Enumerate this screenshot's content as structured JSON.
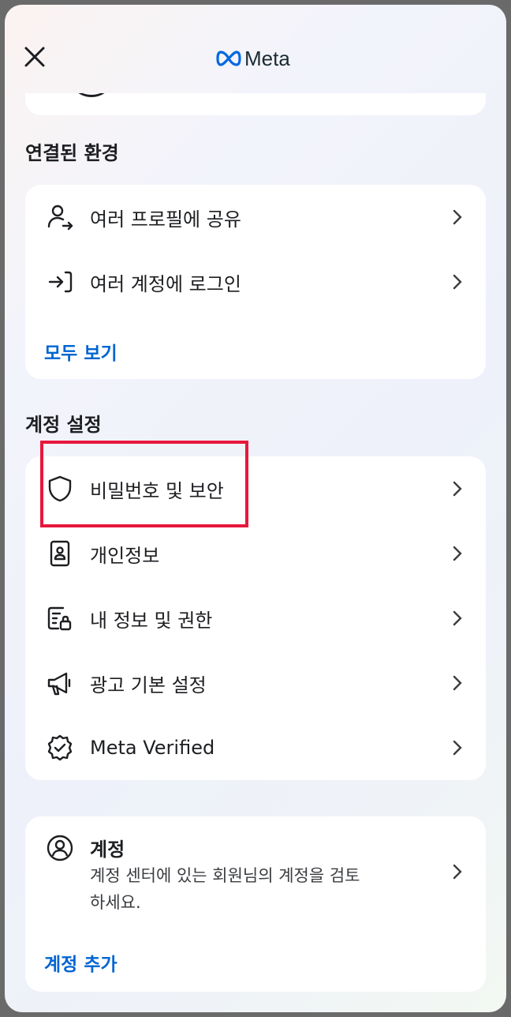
{
  "header": {
    "logo_text": "Meta"
  },
  "connected": {
    "title": "연결된 환경",
    "items": [
      {
        "label": "여러 프로필에 공유",
        "icon": "share-profiles-icon"
      },
      {
        "label": "여러 계정에 로그인",
        "icon": "login-arrow-icon"
      }
    ],
    "see_all": "모두 보기"
  },
  "account_settings": {
    "title": "계정 설정",
    "items": [
      {
        "label": "비밀번호 및 보안",
        "icon": "shield-icon"
      },
      {
        "label": "개인정보",
        "icon": "id-card-icon"
      },
      {
        "label": "내 정보 및 권한",
        "icon": "info-permissions-icon"
      },
      {
        "label": "광고 기본 설정",
        "icon": "megaphone-icon"
      },
      {
        "label": "Meta Verified",
        "icon": "verified-badge-icon"
      }
    ]
  },
  "accounts": {
    "title": "계정",
    "description": "계정 센터에 있는 회원님의 계정을 검토하세요.",
    "add": "계정 추가"
  },
  "colors": {
    "link": "#0064d1",
    "highlight": "#e8173d"
  }
}
